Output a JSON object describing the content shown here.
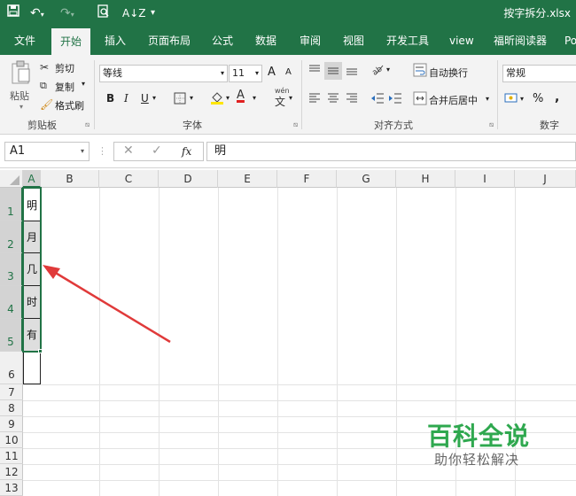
{
  "title_bar": {
    "quick_access": [
      "save-icon",
      "undo-icon",
      "redo-icon",
      "print-preview-icon",
      "sort-icon",
      "customize-icon"
    ],
    "filename": "按字拆分.xlsx"
  },
  "tabs": [
    "文件",
    "开始",
    "插入",
    "页面布局",
    "公式",
    "数据",
    "审阅",
    "视图",
    "开发工具",
    "view",
    "福昕阅读器",
    "Po"
  ],
  "active_tab": "开始",
  "clipboard": {
    "paste": "粘贴",
    "cut": "剪切",
    "copy": "复制",
    "format_painter": "格式刷",
    "label": "剪贴板"
  },
  "font": {
    "name": "等线",
    "size": "11",
    "grow": "A",
    "shrink": "A",
    "bold": "B",
    "italic": "I",
    "underline": "U",
    "label": "字体",
    "pinyin": "wén"
  },
  "alignment": {
    "wrap": "自动换行",
    "merge": "合并后居中",
    "label": "对齐方式"
  },
  "number": {
    "format": "常规",
    "percent": "%",
    "comma": ",",
    "label": "数字"
  },
  "formula_bar": {
    "name_box": "A1",
    "fx": "fx",
    "content": "明"
  },
  "columns": [
    "A",
    "B",
    "C",
    "D",
    "E",
    "F",
    "G",
    "H",
    "I",
    "J"
  ],
  "rows": [
    "1",
    "2",
    "3",
    "4",
    "5",
    "6",
    "7",
    "8",
    "9",
    "10",
    "11",
    "12",
    "13"
  ],
  "cells": [
    "明",
    "月",
    "几",
    "时",
    "有"
  ],
  "watermark": {
    "title": "百科全说",
    "subtitle": "助你轻松解决"
  },
  "colors": {
    "excel_green": "#217346",
    "arrow_red": "#e03a3a",
    "selection_green": "#217346"
  }
}
